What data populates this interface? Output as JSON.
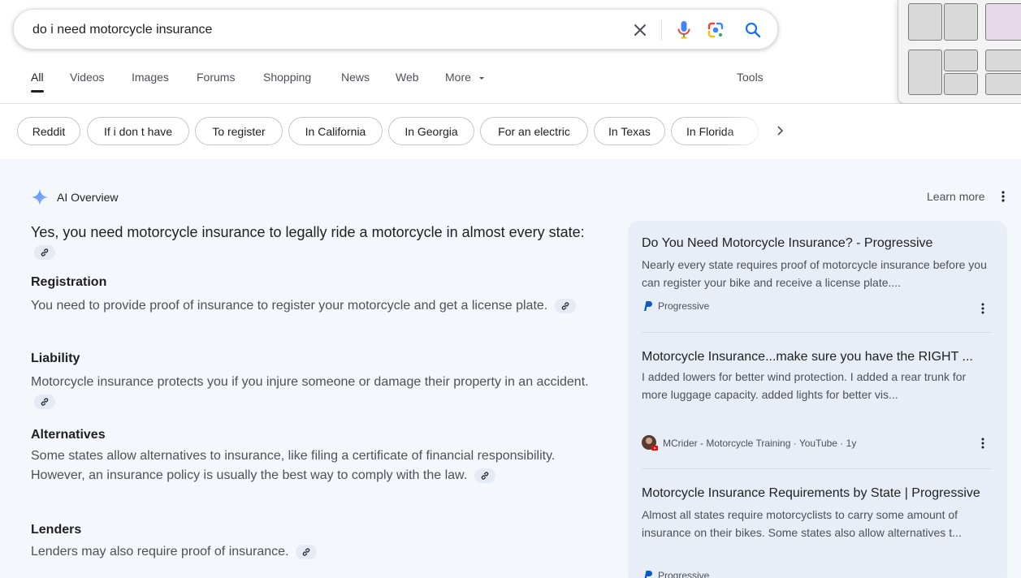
{
  "search": {
    "query": "do i need motorcycle insurance"
  },
  "tabs": [
    {
      "label": "All"
    },
    {
      "label": "Videos"
    },
    {
      "label": "Images"
    },
    {
      "label": "Forums"
    },
    {
      "label": "Shopping"
    },
    {
      "label": "News"
    },
    {
      "label": "Web"
    },
    {
      "label": "More"
    }
  ],
  "tools_label": "Tools",
  "chips": [
    {
      "label": "Reddit"
    },
    {
      "label": "If i don t have"
    },
    {
      "label": "To register"
    },
    {
      "label": "In California"
    },
    {
      "label": "In Georgia"
    },
    {
      "label": "For an electric"
    },
    {
      "label": "In Texas"
    },
    {
      "label": "In Florida"
    }
  ],
  "ai_overview": {
    "title": "AI Overview",
    "learn_more": "Learn more",
    "lead": "Yes, you need motorcycle insurance to legally ride a motorcycle in almost every state:",
    "sections": [
      {
        "heading": "Registration",
        "body": "You need to provide proof of insurance to register your motorcycle and get a license plate."
      },
      {
        "heading": "Liability",
        "body": "Motorcycle insurance protects you if you injure someone or damage their property in an accident."
      },
      {
        "heading": "Alternatives",
        "body": "Some states allow alternatives to insurance, like filing a certificate of financial responsibility. However, an insurance policy is usually the best way to comply with the law."
      },
      {
        "heading": "Lenders",
        "body": "Lenders may also require proof of insurance."
      }
    ]
  },
  "sources": [
    {
      "title": "Do You Need Motorcycle Insurance? - Progressive",
      "snippet": "Nearly every state requires proof of motorcycle insurance before you can register your bike and receive a license plate....",
      "site": "Progressive"
    },
    {
      "title": "Motorcycle Insurance...make sure you have the RIGHT ...",
      "snippet": "I added lowers for better wind protection. I added a rear trunk for more luggage capacity. added lights for better vis...",
      "site": "MCrider - Motorcycle Training · YouTube · 1y"
    },
    {
      "title": "Motorcycle Insurance Requirements by State | Progressive",
      "snippet": "Almost all states require motorcyclists to carry some amount of insurance on their bikes. Some states also allow alternatives t...",
      "site": "Progressive"
    }
  ],
  "colors": {
    "accent_blue": "#1a73e8",
    "ai_background": "#f4f7fc",
    "source_card": "#e8eef7",
    "progressive_blue": "#0b5bc1"
  }
}
